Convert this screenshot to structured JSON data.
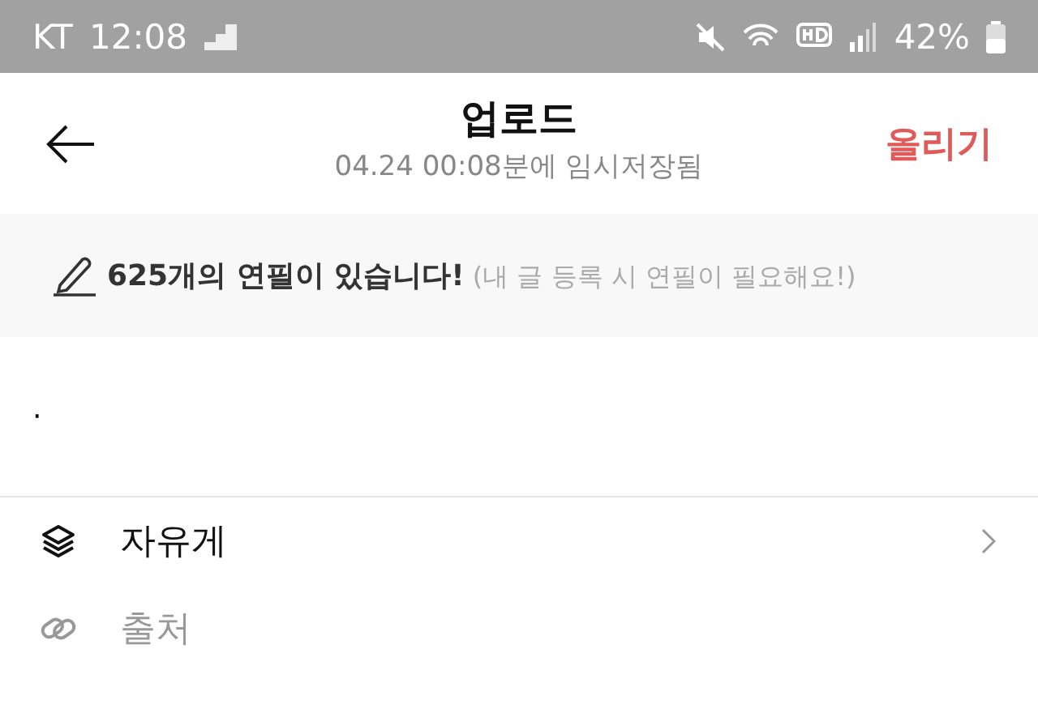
{
  "status_bar": {
    "carrier": "KT",
    "time": "12:08",
    "battery": "42%"
  },
  "header": {
    "title": "업로드",
    "subtitle": "04.24 00:08분에 임시저장됨",
    "action": "올리기"
  },
  "banner": {
    "text": "**625개의 연필이 있습니다!** (내 글 등록 시 연필이 필요해요!)"
  },
  "editor": {
    "value": "·"
  },
  "options": [
    {
      "kind": "board",
      "label": "자유게",
      "disabled": false
    },
    {
      "kind": "source",
      "label": "출처",
      "disabled": true
    }
  ]
}
